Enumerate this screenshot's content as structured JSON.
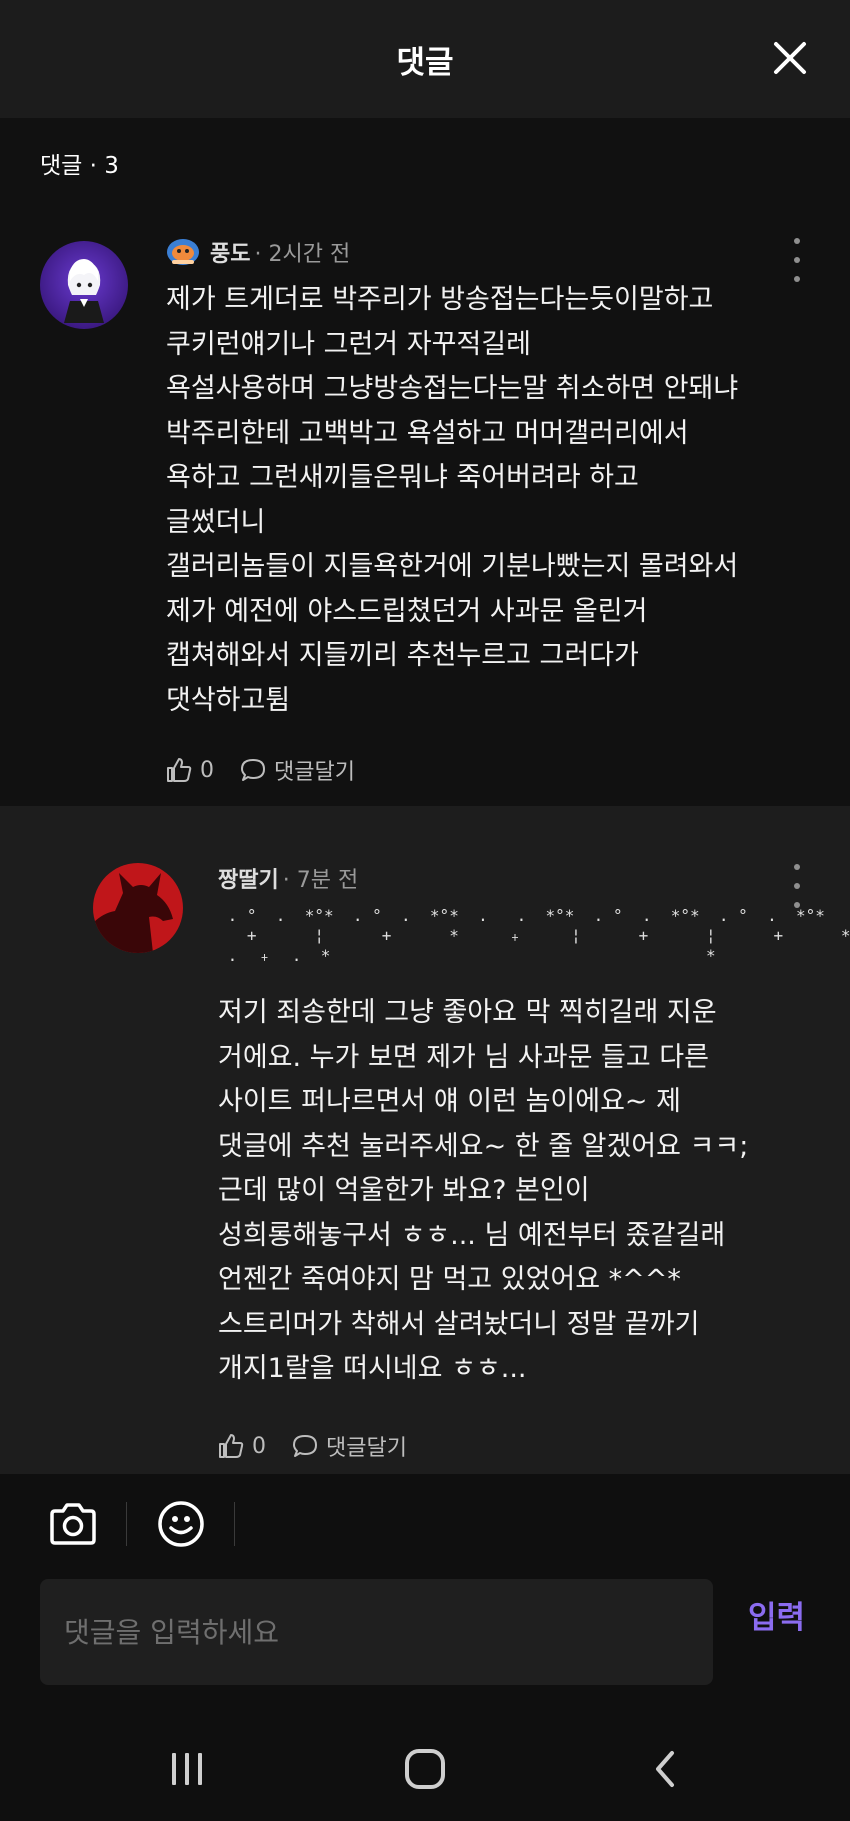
{
  "header": {
    "title": "댓글"
  },
  "comments_count_label": "댓글 · 3",
  "comments": [
    {
      "nickname": "풍도",
      "time": "· 2시간 전",
      "body": "제가 트게더로 박주리가 방송접는다는듯이말하고\n쿠키런얘기나 그런거 자꾸적길레\n욕설사용하며 그냥방송접는다는말 취소하면 안돼냐\n박주리한테 고백박고 욕설하고 머머갤러리에서\n욕하고 그런새끼들은뭐냐 죽어버려라 하고\n글썼더니\n갤러리놈들이 지들욕한거에 기분나빴는지 몰려와서\n제가 예전에 야스드립쳤던거 사과문 올린거\n캡쳐해와서 지들끼리 추천누르고 그러다가\n댓삭하고튐",
      "likes": "0",
      "reply_label": "댓글달기"
    },
    {
      "nickname": "짱딸기",
      "time": "· 7분 전",
      "decoration": " . °  .  *°*  . °  .  *°*  .   .  *°*  . °  .  *°*  . °  .  *°*\n   +      ¦      +      *     ﹢     ¦      +      ¦      +      *\n .  ﹢  .  *                                       *",
      "body": "저기 죄송한데 그냥 좋아요 막 찍히길래 지운\n거에요. 누가 보면 제가 님 사과문 들고 다른\n사이트 퍼나르면서 얘 이런 놈이에요~ 제\n댓글에 추천 눌러주세요~ 한 줄 알겠어요 ㅋㅋ;\n근데 많이 억울한가 봐요? 본인이\n성희롱해놓구서 ㅎㅎ... 님 예전부터 좄같길래\n언젠간 죽여야지 맘 먹고 있었어요 *^^*\n스트리머가 착해서 살려놨더니 정말 끝까기\n개지1랄을 떠시네요 ㅎㅎ...",
      "likes": "0",
      "reply_label": "댓글달기"
    }
  ],
  "composer": {
    "placeholder": "댓글을 입력하세요",
    "submit_label": "입력",
    "camera_icon": "camera-icon",
    "emoji_icon": "emoji-icon"
  },
  "colors": {
    "accent": "#8b6cf0",
    "background": "#111111",
    "header": "#1c1c1c",
    "reply_background": "#1d1d1d"
  }
}
